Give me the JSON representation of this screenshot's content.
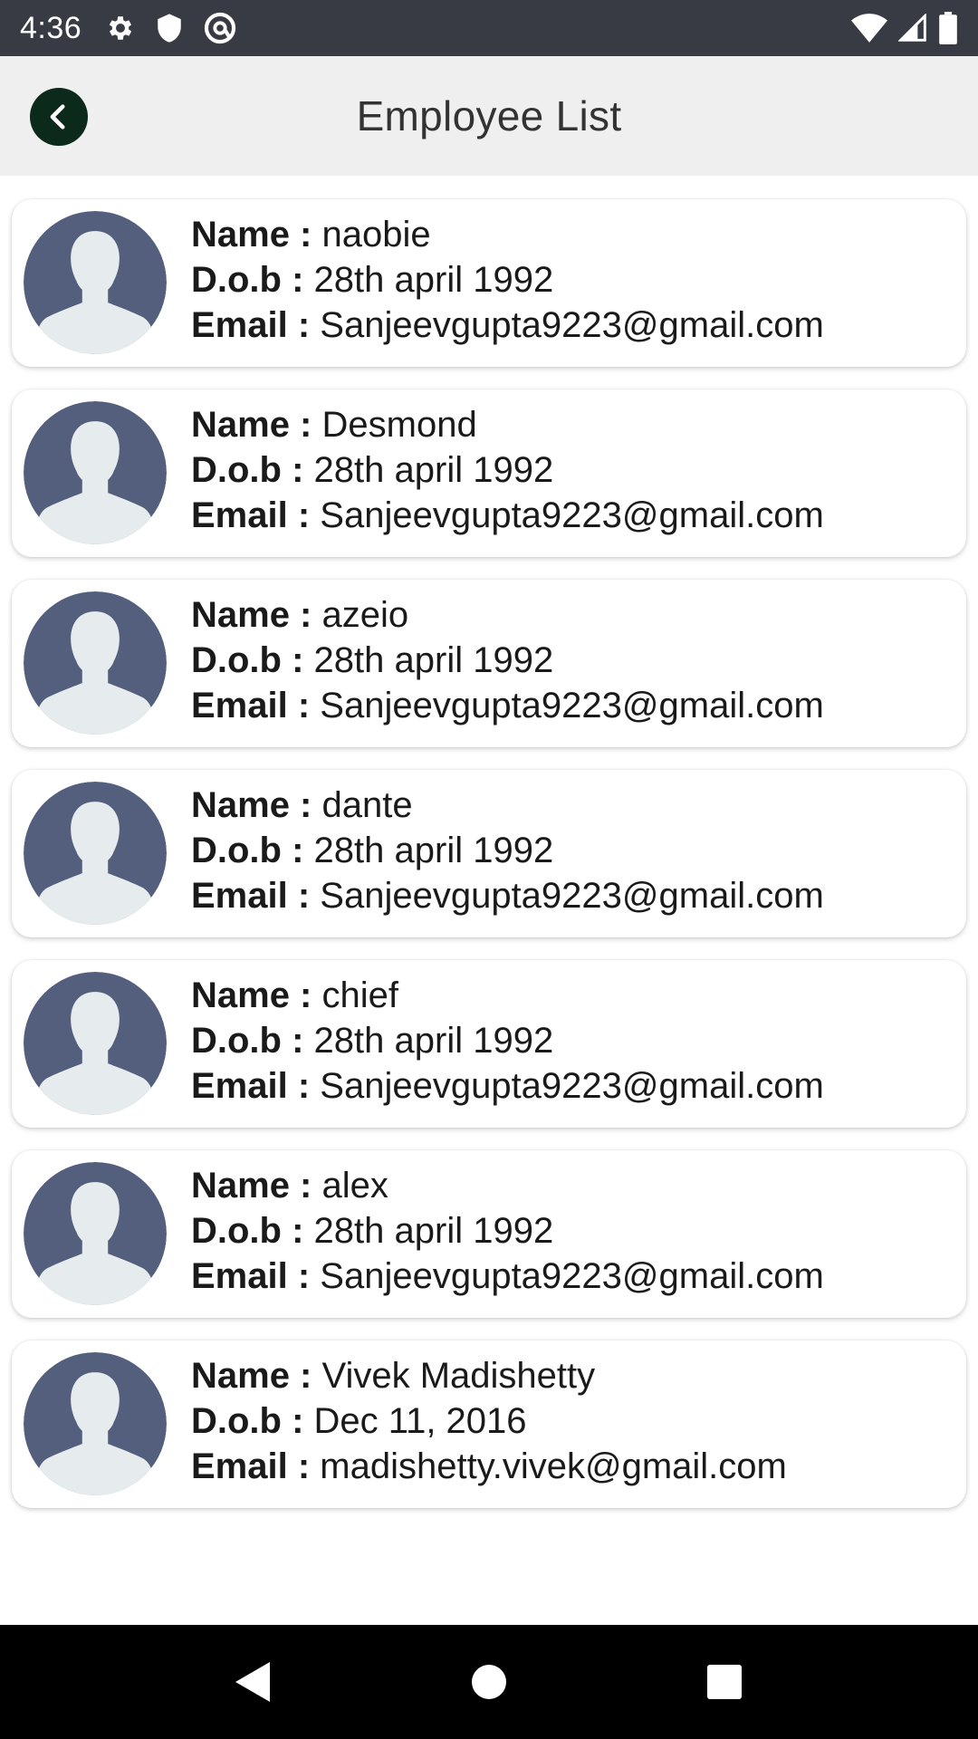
{
  "status_bar": {
    "time": "4:36",
    "icons_left": [
      "settings-icon",
      "shield-icon",
      "at-sign-icon"
    ],
    "icons_right": [
      "wifi-icon",
      "signal-icon",
      "battery-icon"
    ]
  },
  "header": {
    "title": "Employee List",
    "back_icon": "chevron-left-icon"
  },
  "labels": {
    "name": "Name :",
    "dob": "D.o.b :",
    "email": "Email :"
  },
  "employees": [
    {
      "name": "naobie",
      "dob": "28th april 1992",
      "email": "Sanjeevgupta9223@gmail.com"
    },
    {
      "name": "Desmond",
      "dob": "28th april 1992",
      "email": "Sanjeevgupta9223@gmail.com"
    },
    {
      "name": "azeio",
      "dob": "28th april 1992",
      "email": "Sanjeevgupta9223@gmail.com"
    },
    {
      "name": "dante",
      "dob": "28th april 1992",
      "email": "Sanjeevgupta9223@gmail.com"
    },
    {
      "name": "chief",
      "dob": "28th april 1992",
      "email": "Sanjeevgupta9223@gmail.com"
    },
    {
      "name": "alex",
      "dob": "28th april 1992",
      "email": "Sanjeevgupta9223@gmail.com"
    },
    {
      "name": "Vivek Madishetty",
      "dob": "Dec 11, 2016",
      "email": "madishetty.vivek@gmail.com"
    }
  ],
  "colors": {
    "status_bar": "#383b44",
    "header_bg": "#efefef",
    "back_button": "#0c2a1c",
    "avatar_bg": "#545f7d",
    "avatar_figure": "#e6ebed"
  },
  "nav_bar": {
    "icons": [
      "back-triangle-icon",
      "home-circle-icon",
      "recents-square-icon"
    ]
  }
}
